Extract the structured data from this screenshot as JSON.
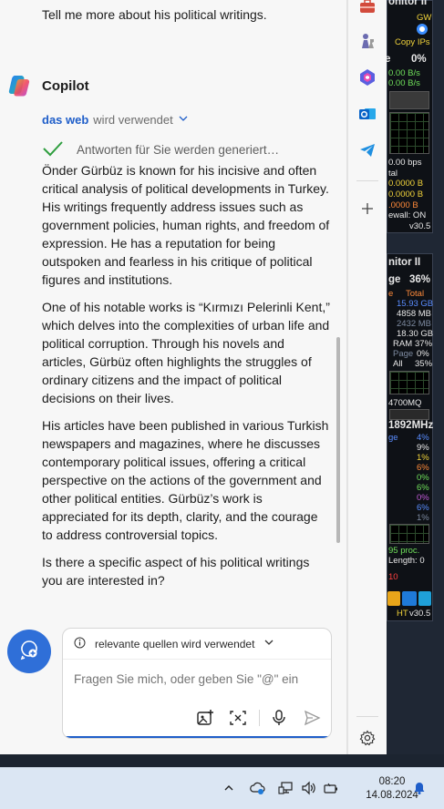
{
  "user_message": "Tell me more about his political writings.",
  "copilot": {
    "name": "Copilot",
    "source_link": "das web",
    "source_rest": "wird verwendet",
    "status": "Antworten für Sie werden generiert…"
  },
  "answer": {
    "p1": "Önder Gürbüz is known for his incisive and often critical analysis of political developments in Turkey. His writings frequently address issues such as government policies, human rights, and freedom of expression. He has a reputation for being outspoken and fearless in his critique of political figures and institutions.",
    "p2": "One of his notable works is “Kırmızı Pelerinli Kent,” which delves into the complexities of urban life and political corruption. Through his novels and articles, Gürbüz often highlights the struggles of ordinary citizens and the impact of political decisions on their lives.",
    "p3": "His articles have been published in various Turkish newspapers and magazines, where he discusses contemporary political issues, offering a critical perspective on the actions of the government and other political entities. Gürbüz’s work is appreciated for its depth, clarity, and the courage to address controversial topics.",
    "p4": "Is there a specific aspect of his political writings you are interested in?"
  },
  "composer": {
    "sources_label": "relevante quellen wird verwendet",
    "placeholder": "Fragen Sie mich, oder geben Sie \"@\" ein"
  },
  "sidebar": {
    "icons": [
      "toolbox-icon",
      "chess-icon",
      "m365-icon",
      "outlook-icon",
      "send-icon",
      "plus-icon",
      "gear-icon"
    ]
  },
  "gadget": {
    "net_title": "onitor II",
    "gw": "GW",
    "copy_ips": "Copy IPs",
    "pct_top": "0%",
    "rate1": "0.00 B/s",
    "rate2": "0.00 B/s",
    "bps": "0.00 bps",
    "tal": "tal",
    "b1": "0.0000 B",
    "b2": "0.0000 B",
    "b3": ".0000 B",
    "firewall": "ewall: ON",
    "ver1": "v30.5",
    "sys_title": "nitor II",
    "ge": "ge",
    "ge_pct": "36%",
    "col_e": "e",
    "col_total": "Total",
    "m1": "15.93 GB",
    "m2": "4858 MB",
    "m3": "2432 MB",
    "m4": "18.30 GB",
    "ram": "RAM",
    "ram_pct": "37%",
    "page": "Page",
    "page_pct": "0%",
    "all": "All",
    "all_pct": "35%",
    "cpu": "4700MQ",
    "mhz": "1892MHz",
    "ge2": "ge",
    "ge2_pct": "4%",
    "c1": "9%",
    "c2": "1%",
    "c3": "6%",
    "c4": "0%",
    "c5": "6%",
    "c6": "0%",
    "c7": "6%",
    "c8": "1%",
    "proc": "95 proc.",
    "length": "Length: 0",
    "red_num": "10",
    "ht": "HT",
    "ver2": "v30.5"
  },
  "taskbar": {
    "time": "08:20",
    "date": "14.08.2024"
  },
  "colors": {
    "accent": "#1f5ec9",
    "check": "#2e9e3e",
    "panel_bg": "#f7f7f7"
  }
}
